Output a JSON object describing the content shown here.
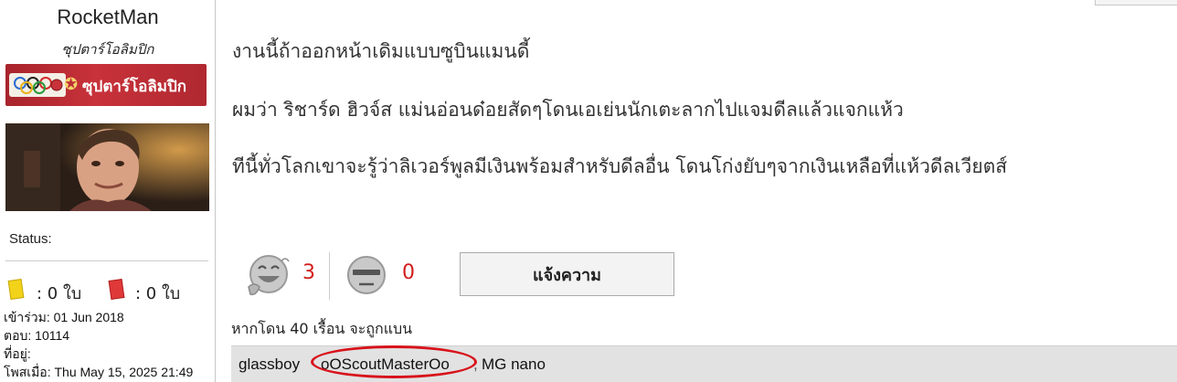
{
  "profile": {
    "username": "RocketMan",
    "rank_title": "ซุปตาร์โอลิมปิก",
    "rank_banner_text": "ซุปตาร์โอลิมปิก",
    "status_label": "Status:",
    "yellow_cards": ": 0 ใบ",
    "red_cards": ": 0 ใบ",
    "joined": "เข้าร่วม: 01 Jun 2018",
    "replies": "ตอบ: 10114",
    "location": "ที่อยู่:",
    "posted": "โพสเมื่อ: Thu May 15, 2025 21:49",
    "icons": {
      "rank_rings": "olympic-rings-icon",
      "rank_star": "star-icon",
      "yellow_card": "yellow-card-icon",
      "red_card": "red-card-icon"
    }
  },
  "post": {
    "lines": [
      "งานนี้ถ้าออกหน้าเดิมแบบซูบินแมนดี้",
      "ผมว่า ริชาร์ด ฮิวจ์ส แม่นอ่อนด๋อยสัดๆโดนเอเย่นนักเตะลากไปแจมดีลแล้วแจกแห้ว",
      "ทีนี้ทั่วโลกเขาจะรู้ว่าลิเวอร์พูลมีเงินพร้อมสำหรับดีลอื่น โดนโก่งยับๆจากเงินเหลือที่แห้วดีลเวียตส์"
    ]
  },
  "votes": {
    "like_icon": "laughing-face-icon",
    "like_count": "3",
    "neutral_icon": "neutral-face-icon",
    "neutral_count": "0"
  },
  "report_button": "แจ้งความ",
  "ban_note": "หากโดน 40 เรื้อน จะถูกแบน",
  "voters": {
    "names": [
      "glassboy",
      "oOScoutMasterOo",
      "MG nano"
    ],
    "separator": ","
  },
  "colors": {
    "vote_count": "#d21c1c",
    "banner_red": "#b02830",
    "highlight": "#d8121a",
    "voters_bg": "#e2e2e2"
  }
}
